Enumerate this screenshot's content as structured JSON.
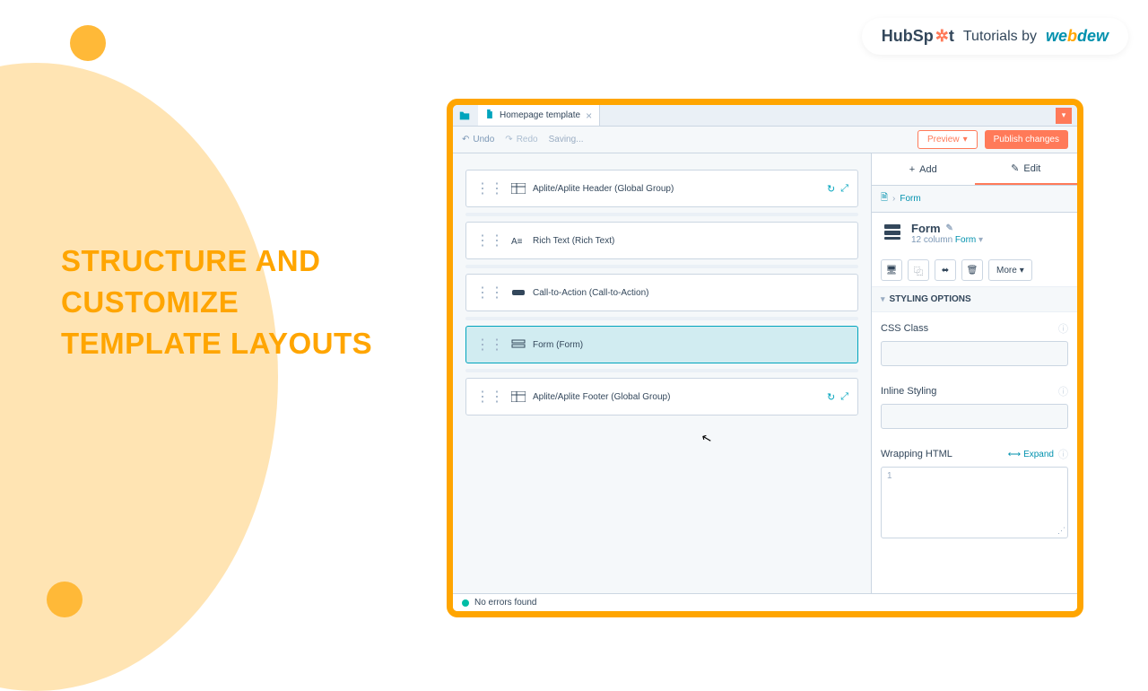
{
  "title": "STRUCTURE AND\nCUSTOMIZE\nTEMPLATE LAYOUTS",
  "branding": {
    "hubspot": "HubSp",
    "tutorials": "Tutorials by",
    "webdew": "webdew"
  },
  "tab": {
    "name": "Homepage template"
  },
  "toolbar": {
    "undo": "Undo",
    "redo": "Redo",
    "saving": "Saving...",
    "preview": "Preview",
    "publish": "Publish changes"
  },
  "modules": [
    {
      "label": "Aplite/Aplite Header (Global Group)",
      "global": true
    },
    {
      "label": "Rich Text (Rich Text)",
      "global": false
    },
    {
      "label": "Call-to-Action (Call-to-Action)",
      "global": false
    },
    {
      "label": "Form (Form)",
      "global": false,
      "selected": true
    },
    {
      "label": "Aplite/Aplite Footer (Global Group)",
      "global": true
    }
  ],
  "sidebar": {
    "add": "Add",
    "edit": "Edit",
    "breadcrumb_form": "Form",
    "module_title": "Form",
    "module_subtitle_columns": "12 column",
    "module_subtitle_type": "Form",
    "more": "More",
    "styling_options": "STYLING OPTIONS",
    "css_class": "CSS Class",
    "inline_styling": "Inline Styling",
    "wrapping_html": "Wrapping HTML",
    "expand": "Expand",
    "line_number": "1"
  },
  "status": {
    "text": "No errors found"
  }
}
